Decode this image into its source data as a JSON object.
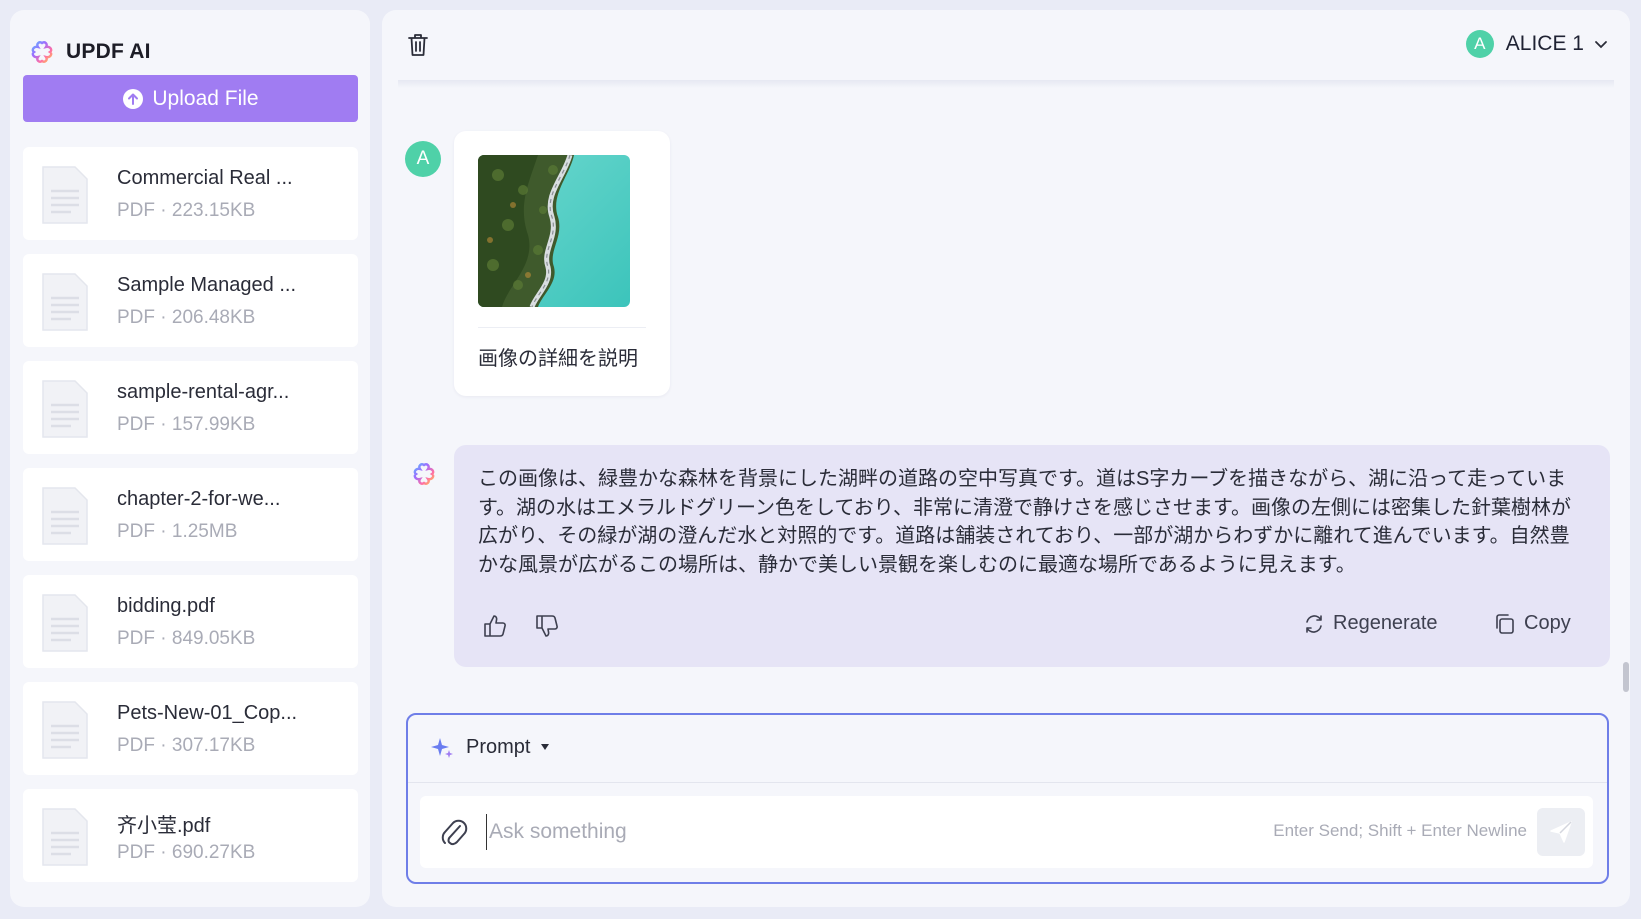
{
  "app": {
    "name": "UPDF AI"
  },
  "sidebar": {
    "upload_label": "Upload File",
    "files": [
      {
        "name": "Commercial Real ...",
        "meta": "PDF · 223.15KB"
      },
      {
        "name": "Sample Managed ...",
        "meta": "PDF · 206.48KB"
      },
      {
        "name": "sample-rental-agr...",
        "meta": "PDF · 157.99KB"
      },
      {
        "name": "chapter-2-for-we...",
        "meta": "PDF · 1.25MB"
      },
      {
        "name": "bidding.pdf",
        "meta": "PDF · 849.05KB"
      },
      {
        "name": "Pets-New-01_Cop...",
        "meta": "PDF · 307.17KB"
      },
      {
        "name": "齐小莹.pdf",
        "meta": "PDF · 690.27KB"
      }
    ]
  },
  "header": {
    "user_initial": "A",
    "user_name": "ALICE 1"
  },
  "chat": {
    "user_initial": "A",
    "user_question": "画像の詳細を説明",
    "ai_answer": "この画像は、緑豊かな森林を背景にした湖畔の道路の空中写真です。道はS字カーブを描きながら、湖に沿って走っています。湖の水はエメラルドグリーン色をしており、非常に清澄で静けさを感じさせます。画像の左側には密集した針葉樹林が広がり、その緑が湖の澄んだ水と対照的です。道路は舗装されており、一部が湖からわずかに離れて進んでいます。自然豊かな風景が広がるこの場所は、静かで美しい景観を楽しむのに最適な場所であるように見えます。",
    "regenerate_label": "Regenerate",
    "copy_label": "Copy"
  },
  "composer": {
    "prompt_label": "Prompt",
    "placeholder": "Ask something",
    "value": "",
    "hint": "Enter Send; Shift + Enter Newline"
  },
  "colors": {
    "accent": "#a07cf2",
    "avatar": "#4fd1a8",
    "ai_bubble": "#e6e4f6",
    "composer_border": "#6f7ee8"
  }
}
